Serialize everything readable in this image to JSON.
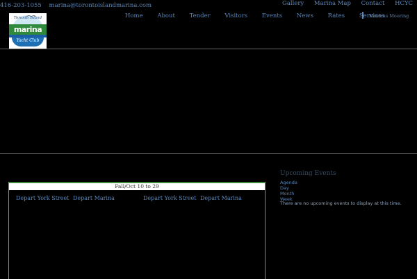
{
  "contact": {
    "phone": "416-203-1055",
    "email": "marina@torontoislandmarina.com"
  },
  "top_links": [
    "Gallery",
    "Marina Map",
    "Contact",
    "HCYC"
  ],
  "logo": {
    "top_text": "Toronto Island",
    "wordmark": "marina",
    "sub_text": "Yacht Club"
  },
  "nav": [
    "Home",
    "About",
    "Tender",
    "Visitors",
    "Events",
    "News",
    "Rates",
    "Services"
  ],
  "nav_extra": "Hanlans Mooring",
  "upcoming_events": {
    "title": "Upcoming Events",
    "links": [
      "Agenda",
      "Day",
      "Month",
      "Week"
    ],
    "empty_text": "There are no upcoming events to display at this time."
  },
  "schedule": {
    "header": "Fall/Oct 10 to 29",
    "columns": [
      "Depart York Street",
      "Depart Marina",
      "Depart York Street",
      "Depart Marina"
    ]
  },
  "colors": {
    "background": "#000000",
    "link": "#5b86b8",
    "accent_green": "#3a8a3a"
  }
}
